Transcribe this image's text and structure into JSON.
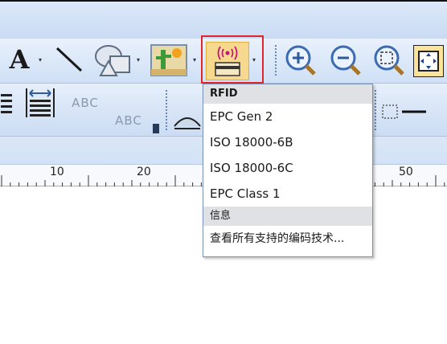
{
  "toolbar": {
    "text_tool_label": "A",
    "abc_label_1": "ABC",
    "abc_label_2": "ABC"
  },
  "ruler": {
    "labels": [
      "10",
      "20",
      "50"
    ]
  },
  "rfid_menu": {
    "header_rfid": "RFID",
    "items": [
      "EPC Gen 2",
      "ISO 18000-6B",
      "ISO 18000-6C",
      "EPC Class 1"
    ],
    "header_info": "信息",
    "info_item": "查看所有支持的编码技术..."
  },
  "colors": {
    "highlight": "#e0262b",
    "toolbar_bg": "#cfe0f6",
    "rfid_icon": "#c2187a"
  },
  "icons": [
    "text-icon",
    "line-icon",
    "shape-icon",
    "picture-icon",
    "rfid-icon",
    "zoom-in-icon",
    "zoom-out-icon",
    "zoom-select-icon",
    "fit-page-icon"
  ]
}
